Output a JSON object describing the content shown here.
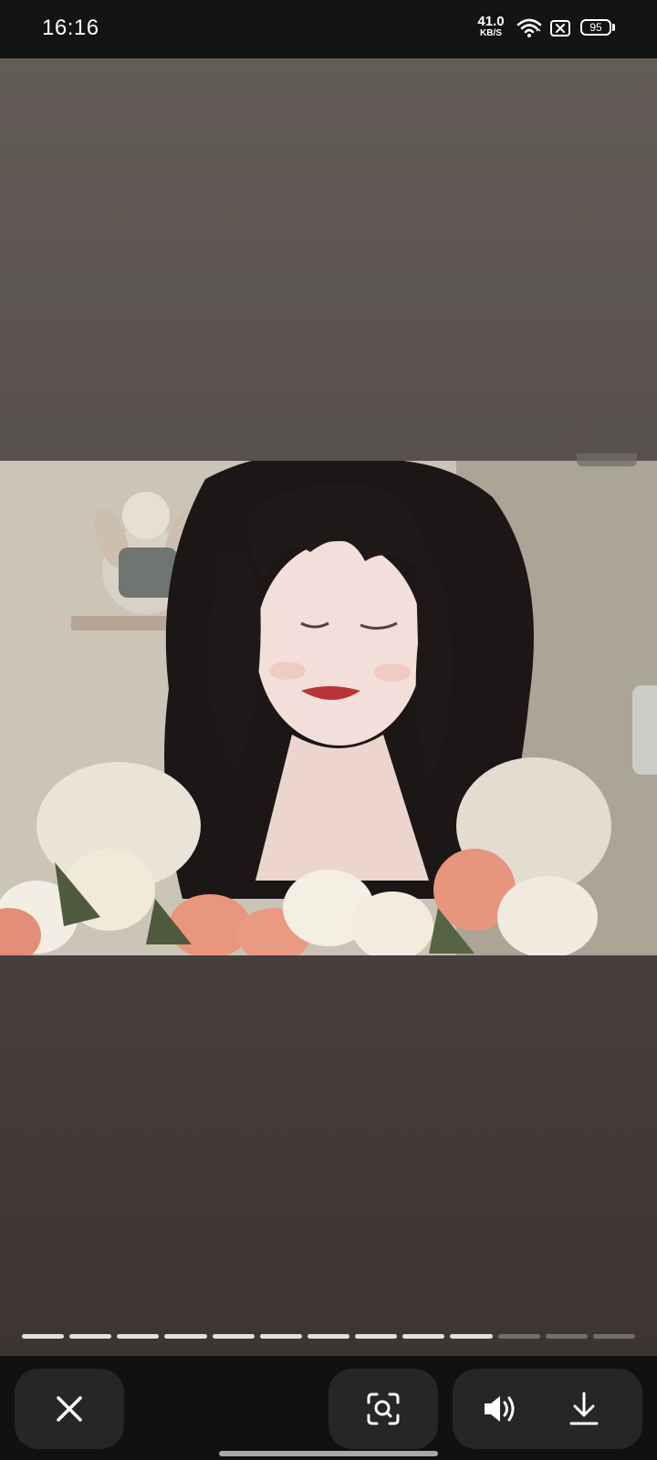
{
  "status_bar": {
    "time": "16:16",
    "net_speed": "41.0",
    "net_unit": "KB/S",
    "battery": "95",
    "icons": [
      "wifi-icon",
      "sim-card-icon",
      "battery-icon"
    ]
  },
  "viewer": {
    "media_type": "photo",
    "photo_subject": "girl with dark hair holding flowers",
    "progress": {
      "total_segments": 13,
      "completed_segments": 10
    }
  },
  "bottom_bar": {
    "buttons": [
      {
        "name": "close",
        "icon": "close-icon"
      },
      {
        "name": "visual-search",
        "icon": "scan-search-icon"
      },
      {
        "name": "sound",
        "icon": "speaker-icon"
      },
      {
        "name": "download",
        "icon": "download-icon"
      }
    ]
  },
  "colors": {
    "status_bar_bg": "#141414",
    "bottom_bar_bg": "#111111",
    "button_bg": "#262626",
    "icon": "#ffffff"
  }
}
